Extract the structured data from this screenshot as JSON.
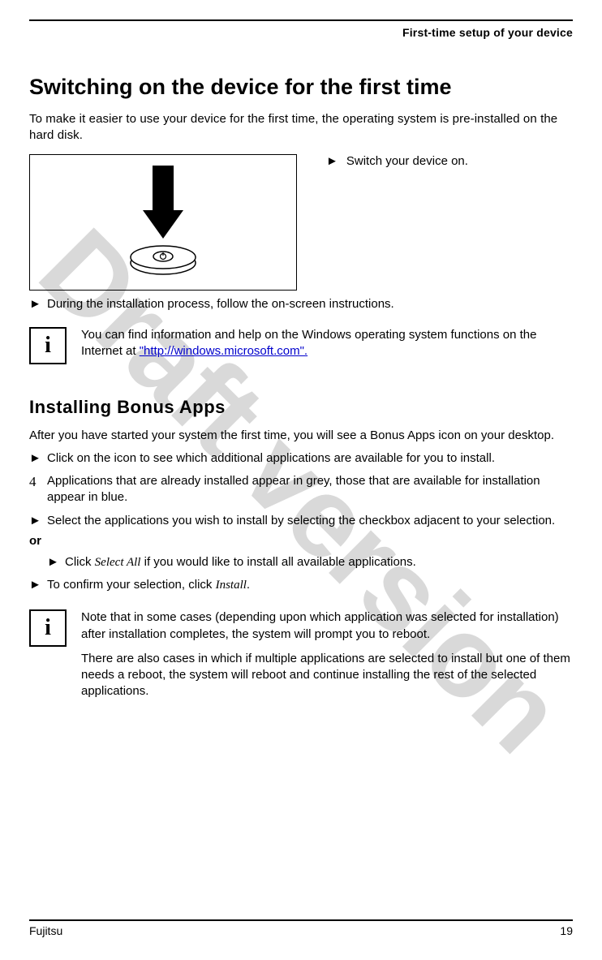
{
  "header": {
    "title": "First-time setup of your device"
  },
  "watermark": "Draft version",
  "section1": {
    "heading": "Switching on the device for the first time",
    "intro": "To make it easier to use your device for the first time, the operating system is pre-installed on the hard disk.",
    "step1": "Switch your device on.",
    "step2": "During the installation process, follow the on-screen instructions.",
    "info_pre": "You can find information and help on the Windows operating system functions on the Internet at ",
    "info_link": "\"http://windows.microsoft.com\".",
    "info_post": ""
  },
  "section2": {
    "heading": "Installing Bonus Apps",
    "intro": "After you have started your system the first time, you will see a Bonus Apps icon on your desktop.",
    "bullet1": "Click on the icon to see which additional applications are available for you to install.",
    "result4": "Applications that are already installed appear in grey, those that are available for installation appear in blue.",
    "bullet2": "Select the applications you wish to install by selecting the checkbox adjacent to your selection.",
    "or": "or",
    "bullet3_pre": "Click ",
    "bullet3_em": "Select All",
    "bullet3_post": " if you would like to install all available applications.",
    "bullet4_pre": "To confirm your selection, click ",
    "bullet4_em": "Install",
    "bullet4_post": ".",
    "info_p1": "Note that in some cases (depending upon which application was selected for installation) after installation completes, the system will prompt you to reboot.",
    "info_p2": "There are also cases in which if multiple applications are selected to install but one of them needs a reboot, the system will reboot and continue installing the rest of the selected applications."
  },
  "footer": {
    "brand": "Fujitsu",
    "page": "19"
  }
}
